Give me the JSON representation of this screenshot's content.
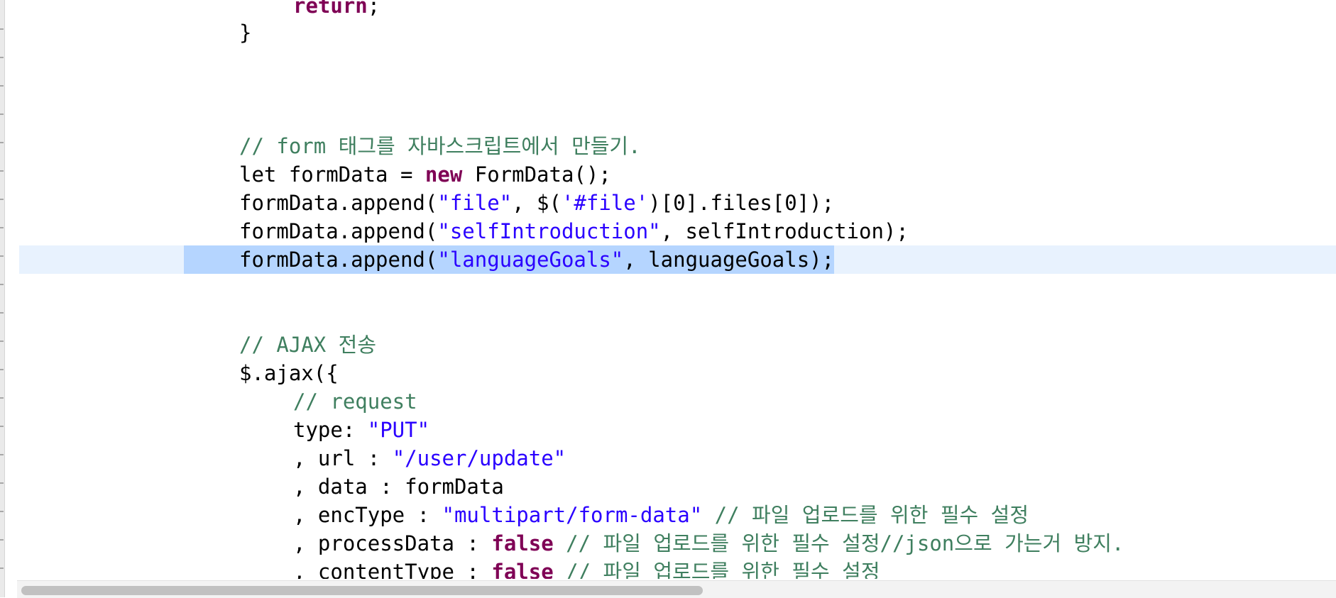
{
  "colors": {
    "keyword": "#7f0055",
    "string": "#2a00ff",
    "comment": "#3f7f5f",
    "current_line": "#e8f2fe",
    "selection": "#b5d5ff"
  },
  "code": {
    "l1_kw": "return",
    "l1_tail": ";",
    "l2": "}",
    "comment_form": "// form 태그를 자바스크립트에서 만들기.",
    "l_let_a": "let formData = ",
    "l_let_kw": "new",
    "l_let_b": " FormData();",
    "append1_a": "formData.append(",
    "append1_s": "\"file\"",
    "append1_b": ", $(",
    "append1_s2": "'#file'",
    "append1_c": ")[0].files[0]);",
    "append2_a": "formData.append(",
    "append2_s": "\"selfIntroduction\"",
    "append2_b": ", selfIntroduction);",
    "append3_a": "formData.append(",
    "append3_s": "\"languageGoals\"",
    "append3_b": ", languageGoals);",
    "comment_ajax": "// AJAX 전송",
    "ajax_open": "$.ajax({",
    "comment_request": "// request",
    "type_a": "type: ",
    "type_s": "\"PUT\"",
    "url_a": ", url : ",
    "url_s": "\"/user/update\"",
    "data_line": ", data : formData",
    "enc_a": ", encType : ",
    "enc_s": "\"multipart/form-data\"",
    "enc_c": " // 파일 업로드를 위한 필수 설정",
    "proc_a": ", processData : ",
    "proc_kw": "false",
    "proc_c": " // 파일 업로드를 위한 필수 설정//json으로 가는거 방지.",
    "ct_a": ", contentType : ",
    "ct_kw": "false",
    "ct_c": " // 파일 업로드를 위한 필수 설정"
  }
}
